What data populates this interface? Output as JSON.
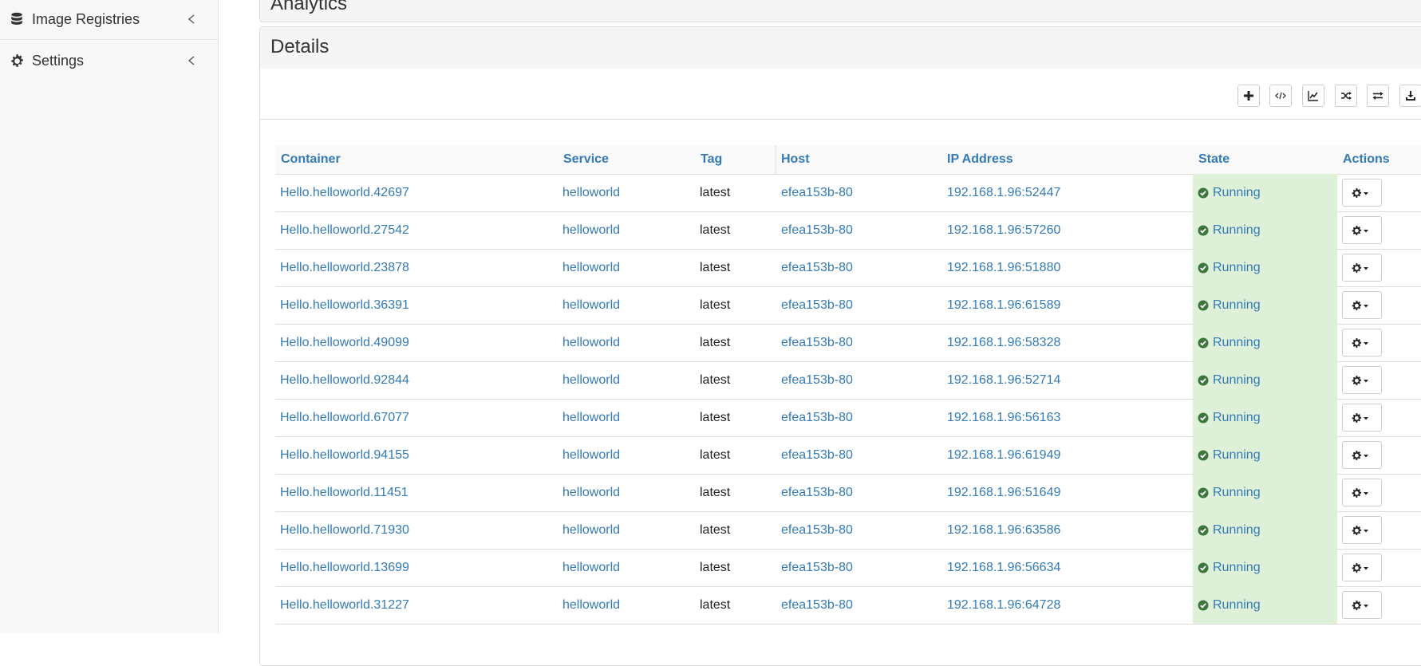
{
  "sidebar": {
    "items": [
      {
        "label": "Image Registries",
        "icon": "database-icon"
      },
      {
        "label": "Settings",
        "icon": "gear-icon"
      }
    ]
  },
  "analytics": {
    "title": "Analytics"
  },
  "details": {
    "title": "Details",
    "toolbar": [
      {
        "name": "add-button",
        "icon": "plus-icon"
      },
      {
        "name": "code-button",
        "icon": "code-icon"
      },
      {
        "name": "chart-button",
        "icon": "line-chart-icon"
      },
      {
        "name": "shuffle-button",
        "icon": "shuffle-icon"
      },
      {
        "name": "exchange-button",
        "icon": "exchange-icon"
      },
      {
        "name": "download-button",
        "icon": "download-icon"
      }
    ]
  },
  "table": {
    "headers": {
      "container": "Container",
      "service": "Service",
      "tag": "Tag",
      "host": "Host",
      "ip": "IP Address",
      "state": "State",
      "actions": "Actions"
    },
    "rows": [
      {
        "container": "Hello.helloworld.42697",
        "service": "helloworld",
        "tag": "latest",
        "host": "efea153b-80",
        "ip": "192.168.1.96:52447",
        "state": "Running"
      },
      {
        "container": "Hello.helloworld.27542",
        "service": "helloworld",
        "tag": "latest",
        "host": "efea153b-80",
        "ip": "192.168.1.96:57260",
        "state": "Running"
      },
      {
        "container": "Hello.helloworld.23878",
        "service": "helloworld",
        "tag": "latest",
        "host": "efea153b-80",
        "ip": "192.168.1.96:51880",
        "state": "Running"
      },
      {
        "container": "Hello.helloworld.36391",
        "service": "helloworld",
        "tag": "latest",
        "host": "efea153b-80",
        "ip": "192.168.1.96:61589",
        "state": "Running"
      },
      {
        "container": "Hello.helloworld.49099",
        "service": "helloworld",
        "tag": "latest",
        "host": "efea153b-80",
        "ip": "192.168.1.96:58328",
        "state": "Running"
      },
      {
        "container": "Hello.helloworld.92844",
        "service": "helloworld",
        "tag": "latest",
        "host": "efea153b-80",
        "ip": "192.168.1.96:52714",
        "state": "Running"
      },
      {
        "container": "Hello.helloworld.67077",
        "service": "helloworld",
        "tag": "latest",
        "host": "efea153b-80",
        "ip": "192.168.1.96:56163",
        "state": "Running"
      },
      {
        "container": "Hello.helloworld.94155",
        "service": "helloworld",
        "tag": "latest",
        "host": "efea153b-80",
        "ip": "192.168.1.96:61949",
        "state": "Running"
      },
      {
        "container": "Hello.helloworld.11451",
        "service": "helloworld",
        "tag": "latest",
        "host": "efea153b-80",
        "ip": "192.168.1.96:51649",
        "state": "Running"
      },
      {
        "container": "Hello.helloworld.71930",
        "service": "helloworld",
        "tag": "latest",
        "host": "efea153b-80",
        "ip": "192.168.1.96:63586",
        "state": "Running"
      },
      {
        "container": "Hello.helloworld.13699",
        "service": "helloworld",
        "tag": "latest",
        "host": "efea153b-80",
        "ip": "192.168.1.96:56634",
        "state": "Running"
      },
      {
        "container": "Hello.helloworld.31227",
        "service": "helloworld",
        "tag": "latest",
        "host": "efea153b-80",
        "ip": "192.168.1.96:64728",
        "state": "Running"
      }
    ]
  },
  "colors": {
    "link": "#337ab7",
    "running_bg": "#dff0d8",
    "running_icon": "#3c763d"
  }
}
